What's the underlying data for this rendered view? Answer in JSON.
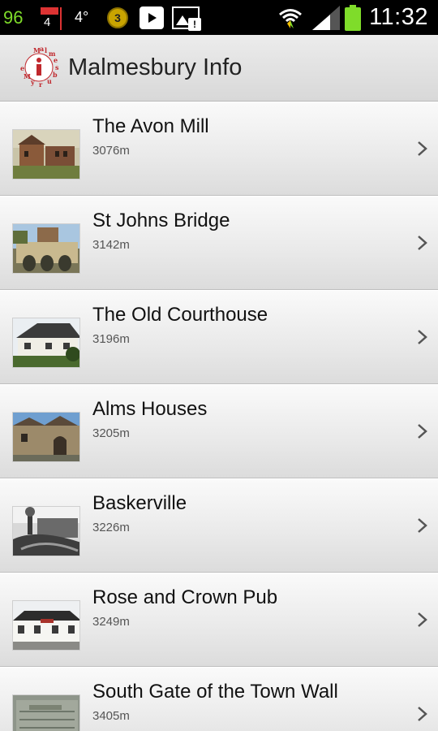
{
  "status_bar": {
    "battery_percent": "96",
    "notification_count": "4",
    "temperature": "4°",
    "coin_count": "3",
    "time": "11:32",
    "icons": [
      "flag-notification-icon",
      "coin-icon",
      "play-store-icon",
      "gallery-warning-icon",
      "wifi-icon",
      "signal-icon",
      "battery-icon"
    ]
  },
  "action_bar": {
    "title": "Malmesbury Info",
    "logo_text": "Malmesbury",
    "logo_letter": "i"
  },
  "places": [
    {
      "title": "The Avon Mill",
      "distance": "3076m"
    },
    {
      "title": "St Johns Bridge",
      "distance": "3142m"
    },
    {
      "title": "The Old Courthouse",
      "distance": "3196m"
    },
    {
      "title": "Alms Houses",
      "distance": "3205m"
    },
    {
      "title": "Baskerville",
      "distance": "3226m"
    },
    {
      "title": "Rose and Crown Pub",
      "distance": "3249m"
    },
    {
      "title": "South Gate of the Town Wall",
      "distance": "3405m"
    }
  ],
  "colors": {
    "status_bar_bg": "#000000",
    "battery_green": "#7fdc2a",
    "logo_red": "#c0282d",
    "title_text": "#222222"
  }
}
